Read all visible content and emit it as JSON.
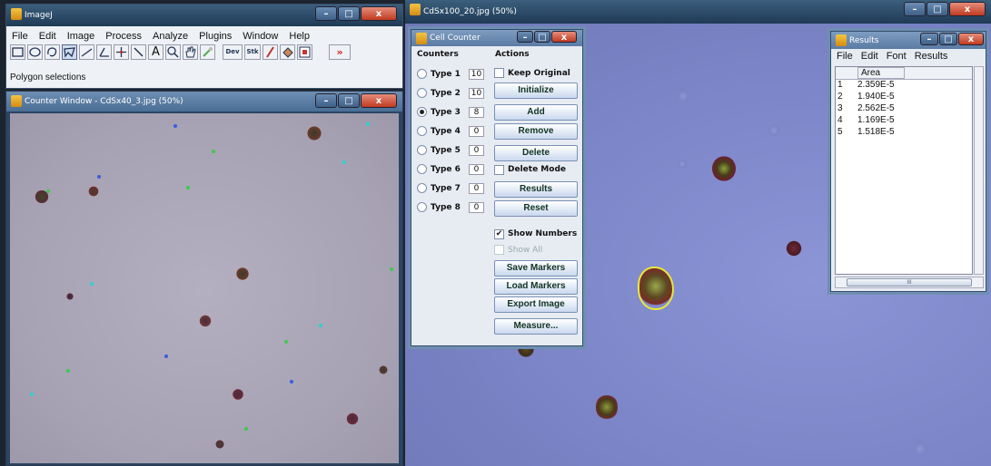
{
  "imagej": {
    "title": "ImageJ",
    "menu": [
      "File",
      "Edit",
      "Image",
      "Process",
      "Analyze",
      "Plugins",
      "Window",
      "Help"
    ],
    "tools": [
      "rectangle-tool-icon",
      "oval-tool-icon",
      "freehand-tool-icon",
      "polygon-tool-icon",
      "line-tool-icon",
      "angle-tool-icon",
      "point-tool-icon",
      "wand-tool-icon",
      "text-tool-icon",
      "magnifier-tool-icon",
      "hand-tool-icon",
      "dropper-tool-icon",
      "dev-tool-icon",
      "stk-tool-icon",
      "brush-tool-icon",
      "flood-tool-icon",
      "lut-tool-icon",
      "more-tools-icon"
    ],
    "dev_label": "Dev",
    "stk_label": "Stk",
    "more_label": "»",
    "status": "Polygon selections"
  },
  "counter_window": {
    "title": "Counter Window - CdSx40_3.jpg (50%)"
  },
  "main_image": {
    "title": "CdSx100_20.jpg (50%)"
  },
  "cell_counter": {
    "title": "Cell Counter",
    "counters_label": "Counters",
    "actions_label": "Actions",
    "types": [
      {
        "label": "Type 1",
        "count": "10",
        "selected": false
      },
      {
        "label": "Type 2",
        "count": "10",
        "selected": false
      },
      {
        "label": "Type 3",
        "count": "8",
        "selected": true
      },
      {
        "label": "Type 4",
        "count": "0",
        "selected": false
      },
      {
        "label": "Type 5",
        "count": "0",
        "selected": false
      },
      {
        "label": "Type 6",
        "count": "0",
        "selected": false
      },
      {
        "label": "Type 7",
        "count": "0",
        "selected": false
      },
      {
        "label": "Type 8",
        "count": "0",
        "selected": false
      }
    ],
    "keep_original": "Keep Original",
    "initialize": "Initialize",
    "add": "Add",
    "remove": "Remove",
    "delete": "Delete",
    "delete_mode": "Delete Mode",
    "results": "Results",
    "reset": "Reset",
    "show_numbers": "Show Numbers",
    "show_numbers_check": "✔",
    "show_all": "Show All",
    "save_markers": "Save Markers",
    "load_markers": "Load Markers",
    "export_image": "Export Image",
    "measure": "Measure..."
  },
  "results": {
    "title": "Results",
    "menu": [
      "File",
      "Edit",
      "Font",
      "Results"
    ],
    "column": "Area",
    "rows": [
      {
        "n": "1",
        "area": "2.359E-5"
      },
      {
        "n": "2",
        "area": "1.940E-5"
      },
      {
        "n": "3",
        "area": "2.562E-5"
      },
      {
        "n": "4",
        "area": "1.169E-5"
      },
      {
        "n": "5",
        "area": "1.518E-5"
      }
    ],
    "hscroll_mark": "III"
  },
  "window_buttons": {
    "minimize": "–",
    "maximize": "□",
    "close": "x"
  },
  "colors": {
    "image_bg": "#7d86c6",
    "counter_bg": "#aba7b8",
    "titlebar": "#2b4a66",
    "selection": "#e6e83a"
  }
}
